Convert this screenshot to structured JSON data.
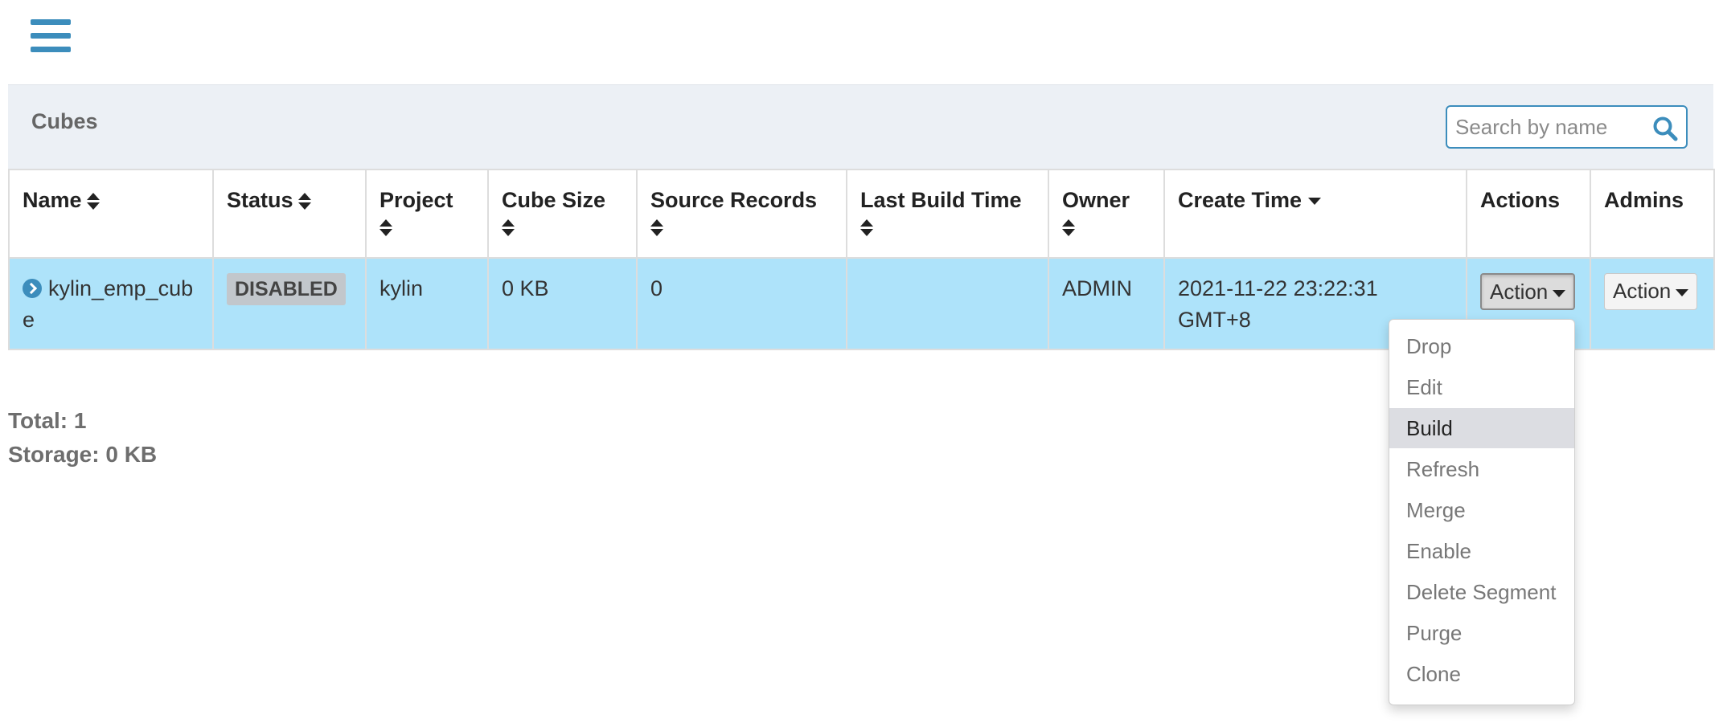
{
  "panel": {
    "title": "Cubes",
    "search_placeholder": "Search by name"
  },
  "table": {
    "headers": {
      "name": "Name",
      "status": "Status",
      "project": "Project",
      "cube_size": "Cube Size",
      "source_records": "Source Records",
      "last_build_time": "Last Build Time",
      "owner": "Owner",
      "create_time": "Create Time",
      "actions": "Actions",
      "admins": "Admins"
    },
    "rows": [
      {
        "name": "kylin_emp_cube",
        "status": "DISABLED",
        "project": "kylin",
        "cube_size": "0 KB",
        "source_records": "0",
        "last_build_time": "",
        "owner": "ADMIN",
        "create_time": "2021-11-22 23:22:31 GMT+8",
        "actions_label": "Action",
        "admins_label": "Action"
      }
    ]
  },
  "action_menu": {
    "items": [
      "Drop",
      "Edit",
      "Build",
      "Refresh",
      "Merge",
      "Enable",
      "Delete Segment",
      "Purge",
      "Clone"
    ],
    "highlighted": "Build"
  },
  "summary": {
    "total": "Total: 1",
    "storage": "Storage: 0 KB"
  },
  "colors": {
    "accent": "#3c8dbc",
    "row_highlight": "#aee3fa",
    "header_bg": "#ecf0f5",
    "badge_bg": "#c2c7cc"
  },
  "icons": {
    "menu": "hamburger-menu-icon",
    "search": "search-icon",
    "expand": "chevron-right-circle-icon",
    "sort": "sort-icon",
    "sort_desc": "caret-down-icon"
  }
}
